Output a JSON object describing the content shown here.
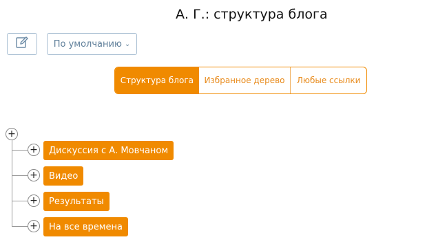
{
  "title": "А. Г.: структура блога",
  "toolbar": {
    "edit_icon": "edit-icon",
    "sort_label": "По умолчанию",
    "sort_chevron": "⌄"
  },
  "tabs": [
    {
      "label": "Структура блога",
      "active": true
    },
    {
      "label": "Избранное дерево",
      "active": false
    },
    {
      "label": "Любые ссылки",
      "active": false
    }
  ],
  "tree": {
    "root_expand": "+",
    "items": [
      {
        "expand": "+",
        "label": "Дискуссия с А. Мовчаном"
      },
      {
        "expand": "+",
        "label": "Видео"
      },
      {
        "expand": "+",
        "label": "Результаты"
      },
      {
        "expand": "+",
        "label": "На все времена"
      }
    ]
  },
  "colors": {
    "accent": "#f08a00",
    "button_border": "#a9bfd3",
    "button_text": "#5f7f9a"
  }
}
